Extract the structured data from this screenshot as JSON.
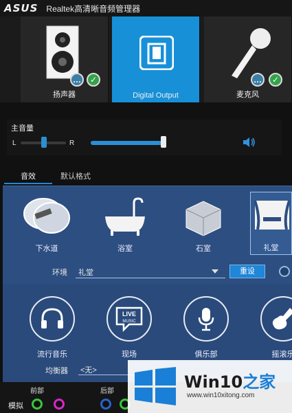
{
  "titlebar": {
    "logo": "ASUS",
    "title": "Realtek高清晰音频管理器"
  },
  "devices": [
    {
      "label": "扬声器",
      "icon": "speaker-cabinet-icon",
      "active": false
    },
    {
      "label": "Digital Output",
      "icon": "digital-output-icon",
      "active": true
    },
    {
      "label": "麦克风",
      "icon": "microphone-icon",
      "active": false
    }
  ],
  "volume": {
    "title": "主音量",
    "left_label": "L",
    "right_label": "R",
    "balance_fraction": 0.5,
    "master_level_fraction": 1.0
  },
  "tabs": [
    {
      "label": "音效",
      "selected": true
    },
    {
      "label": "默认格式",
      "selected": false
    }
  ],
  "environments": [
    {
      "label": "下水道",
      "icon": "sewer-pipe-icon"
    },
    {
      "label": "浴室",
      "icon": "bathtub-icon"
    },
    {
      "label": "石室",
      "icon": "stone-room-icon"
    },
    {
      "label": "礼堂",
      "icon": "auditorium-icon",
      "selected": true
    }
  ],
  "environment_row": {
    "label": "环境",
    "value": "礼堂",
    "reset_label": "重设"
  },
  "equalizer_presets": [
    {
      "label": "流行音乐",
      "icon": "headphones-icon"
    },
    {
      "label": "现场",
      "icon": "live-music-icon",
      "live_text": "LIVE",
      "music_text": "MUSIC"
    },
    {
      "label": "俱乐部",
      "icon": "microphone-stand-icon"
    },
    {
      "label": "摇滚乐",
      "icon": "guitar-icon"
    }
  ],
  "equalizer": {
    "label": "均衡器",
    "value": "<无>"
  },
  "jacks": {
    "front_label": "前部",
    "rear_label": "后部",
    "analog_label": "模拟"
  },
  "watermark": {
    "brand_a": "Win10",
    "brand_b": "之家",
    "url": "www.win10xitong.com"
  },
  "colors": {
    "accent": "#1790d8",
    "panel_blue": "#2d4e80",
    "check_green": "#35a24a"
  }
}
